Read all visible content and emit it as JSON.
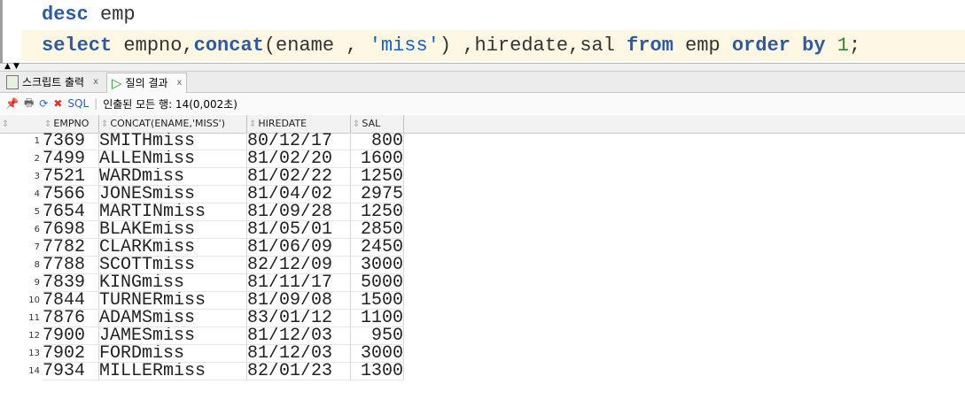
{
  "editor": {
    "line1": {
      "kw": "desc",
      "rest": " emp"
    },
    "line2": {
      "kw1": "select",
      "t1": " empno,",
      "kw2": "concat",
      "t2": "(ename , ",
      "str": "'miss'",
      "t3": ") ,hiredate,sal ",
      "kw3": "from",
      "t4": " emp ",
      "kw4": "order by",
      "t5": " ",
      "num": "1",
      "t6": ";"
    }
  },
  "tabs": [
    {
      "label": "스크립트 출력",
      "close": "x"
    },
    {
      "label": "질의 결과",
      "close": "x"
    }
  ],
  "toolbar": {
    "sql": "SQL",
    "status": "인출된 모든 행: 14(0,002초)"
  },
  "columns": [
    "EMPNO",
    "CONCAT(ENAME,'MISS')",
    "HIREDATE",
    "SAL"
  ],
  "rows": [
    [
      "1",
      "7369",
      "SMITHmiss",
      "80/12/17",
      "800"
    ],
    [
      "2",
      "7499",
      "ALLENmiss",
      "81/02/20",
      "1600"
    ],
    [
      "3",
      "7521",
      "WARDmiss",
      "81/02/22",
      "1250"
    ],
    [
      "4",
      "7566",
      "JONESmiss",
      "81/04/02",
      "2975"
    ],
    [
      "5",
      "7654",
      "MARTINmiss",
      "81/09/28",
      "1250"
    ],
    [
      "6",
      "7698",
      "BLAKEmiss",
      "81/05/01",
      "2850"
    ],
    [
      "7",
      "7782",
      "CLARKmiss",
      "81/06/09",
      "2450"
    ],
    [
      "8",
      "7788",
      "SCOTTmiss",
      "82/12/09",
      "3000"
    ],
    [
      "9",
      "7839",
      "KINGmiss",
      "81/11/17",
      "5000"
    ],
    [
      "10",
      "7844",
      "TURNERmiss",
      "81/09/08",
      "1500"
    ],
    [
      "11",
      "7876",
      "ADAMSmiss",
      "83/01/12",
      "1100"
    ],
    [
      "12",
      "7900",
      "JAMESmiss",
      "81/12/03",
      "950"
    ],
    [
      "13",
      "7902",
      "FORDmiss",
      "81/12/03",
      "3000"
    ],
    [
      "14",
      "7934",
      "MILLERmiss",
      "82/01/23",
      "1300"
    ]
  ]
}
